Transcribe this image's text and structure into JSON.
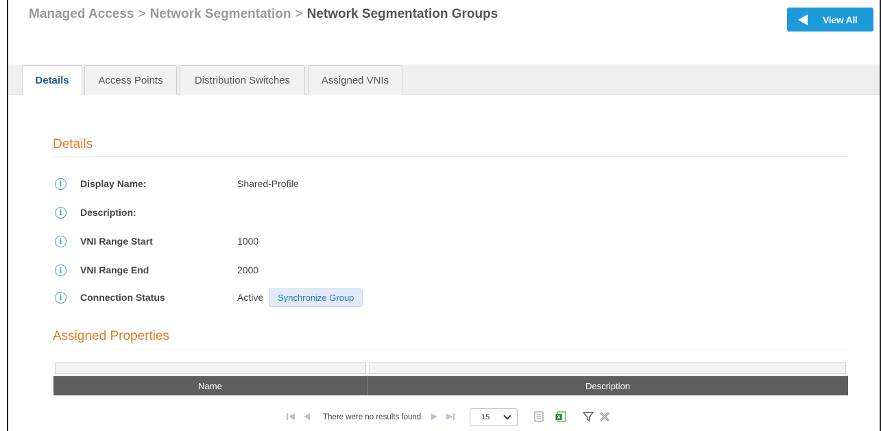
{
  "breadcrumb": {
    "level1": "Managed Access",
    "level2": "Network Segmentation",
    "current": "Network Segmentation Groups",
    "separator": ">"
  },
  "header": {
    "view_all_label": "View All",
    "accent": "#1d9ad9"
  },
  "tabs": [
    {
      "label": "Details",
      "active": true
    },
    {
      "label": "Access Points",
      "active": false
    },
    {
      "label": "Distribution Switches",
      "active": false
    },
    {
      "label": "Assigned VNIs",
      "active": false
    }
  ],
  "details": {
    "title": "Details",
    "fields": [
      {
        "label": "Display Name:",
        "value": "Shared-Profile"
      },
      {
        "label": "Description:",
        "value": ""
      },
      {
        "label": "VNI Range Start",
        "value": "1000"
      },
      {
        "label": "VNI Range End",
        "value": "2000"
      },
      {
        "label": "Connection Status",
        "value": "Active"
      }
    ],
    "sync_button_label": "Synchronize Group",
    "info_glyph": "i"
  },
  "assigned_properties": {
    "title": "Assigned Properties",
    "columns": [
      "Name",
      "Description"
    ]
  },
  "pager": {
    "empty_text": "There were no results found.",
    "page_size": "15"
  },
  "colors": {
    "section_title": "#e07b29",
    "table_header": "#5e5e5e",
    "active_tab_text": "#1b5c94"
  }
}
